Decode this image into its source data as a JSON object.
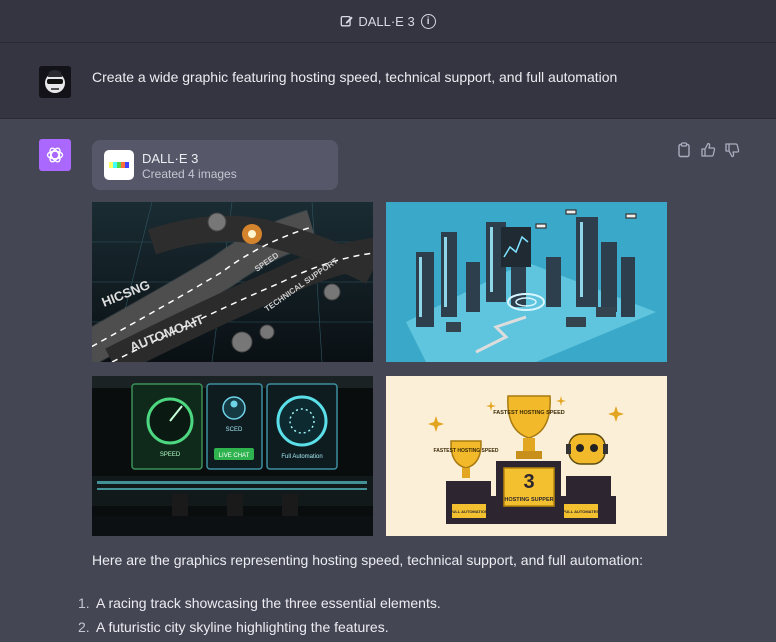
{
  "header": {
    "title": "DALL·E 3",
    "info": "i"
  },
  "user_message": {
    "text": "Create a wide graphic featuring hosting speed, technical support, and full automation"
  },
  "assistant": {
    "tool_card": {
      "title": "DALL·E 3",
      "subtitle": "Created 4 images"
    },
    "images": [
      {
        "label": "racing-track-image",
        "texts": [
          "HICSNG",
          "AUTOMOAIT",
          "SPEED",
          "TECHNICAL SUPPORT"
        ]
      },
      {
        "label": "city-skyline-image"
      },
      {
        "label": "control-room-image",
        "texts": [
          "SPEED",
          "SCED",
          "LIVE CHAT",
          "Full Automation"
        ]
      },
      {
        "label": "trophies-image",
        "texts": [
          "FASTEST HOSTING SPEED",
          "FASTEST HOSTING SPEED",
          "3",
          "HOSTING SUPPER",
          "FULL AUTOMATION",
          "FULL AUTOMATES"
        ]
      }
    ],
    "response_text": "Here are the graphics representing hosting speed, technical support, and full automation:",
    "list": [
      {
        "num": "1.",
        "text": "A racing track showcasing the three essential elements."
      },
      {
        "num": "2.",
        "text": "A futuristic city skyline highlighting the features."
      }
    ]
  },
  "colors": {
    "bg": "#444654",
    "header_bg": "#343541",
    "bot_avatar": "#ab68ff",
    "card": "#565869"
  }
}
